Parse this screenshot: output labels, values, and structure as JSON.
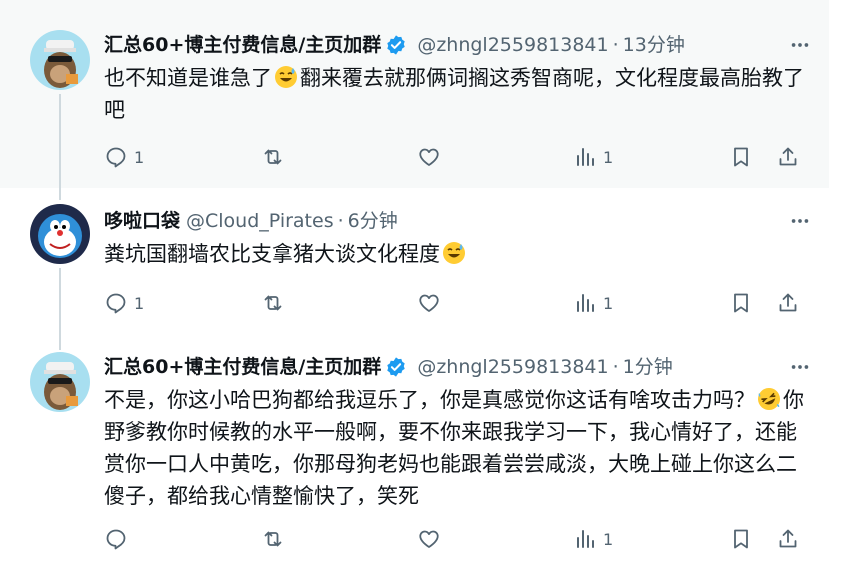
{
  "colors": {
    "text": "#0f1419",
    "secondary": "#536471",
    "verified": "#1d9bf0",
    "highlight_bg": "#f7f9f9",
    "thread_line": "#cfd9de"
  },
  "tweets": [
    {
      "author": "汇总60+博主付费信息/主页加群",
      "verified": true,
      "handle": "@zhngl2559813841",
      "separator": "·",
      "time": "13分钟",
      "text_part1": "也不知道是谁急了",
      "emoji": "sweat-smile",
      "text_part2": "翻来覆去就那俩词搁这秀智商呢，文化程度最高胎教了吧",
      "replies": "1",
      "retweets": "",
      "likes": "",
      "views": "1"
    },
    {
      "author": "哆啦口袋",
      "verified": false,
      "handle": "@Cloud_Pirates",
      "separator": "·",
      "time": "6分钟",
      "text_part1": "粪坑国翻墙农比支拿猪大谈文化程度",
      "emoji": "sweat-smile",
      "text_part2": "",
      "replies": "1",
      "retweets": "",
      "likes": "",
      "views": "1"
    },
    {
      "author": "汇总60+博主付费信息/主页加群",
      "verified": true,
      "handle": "@zhngl2559813841",
      "separator": "·",
      "time": "1分钟",
      "text_part1": "不是，你这小哈巴狗都给我逗乐了，你是真感觉你这话有啥攻击力吗？",
      "emoji": "rofl",
      "text_part2": "你野爹教你时候教的水平一般啊，要不你来跟我学习一下，我心情好了，还能赏你一口人中黄吃，你那母狗老妈也能跟着尝尝咸淡，大晚上碰上你这么二傻子，都给我心情整愉快了，笑死",
      "replies": "",
      "retweets": "",
      "likes": "",
      "views": "1"
    }
  ]
}
